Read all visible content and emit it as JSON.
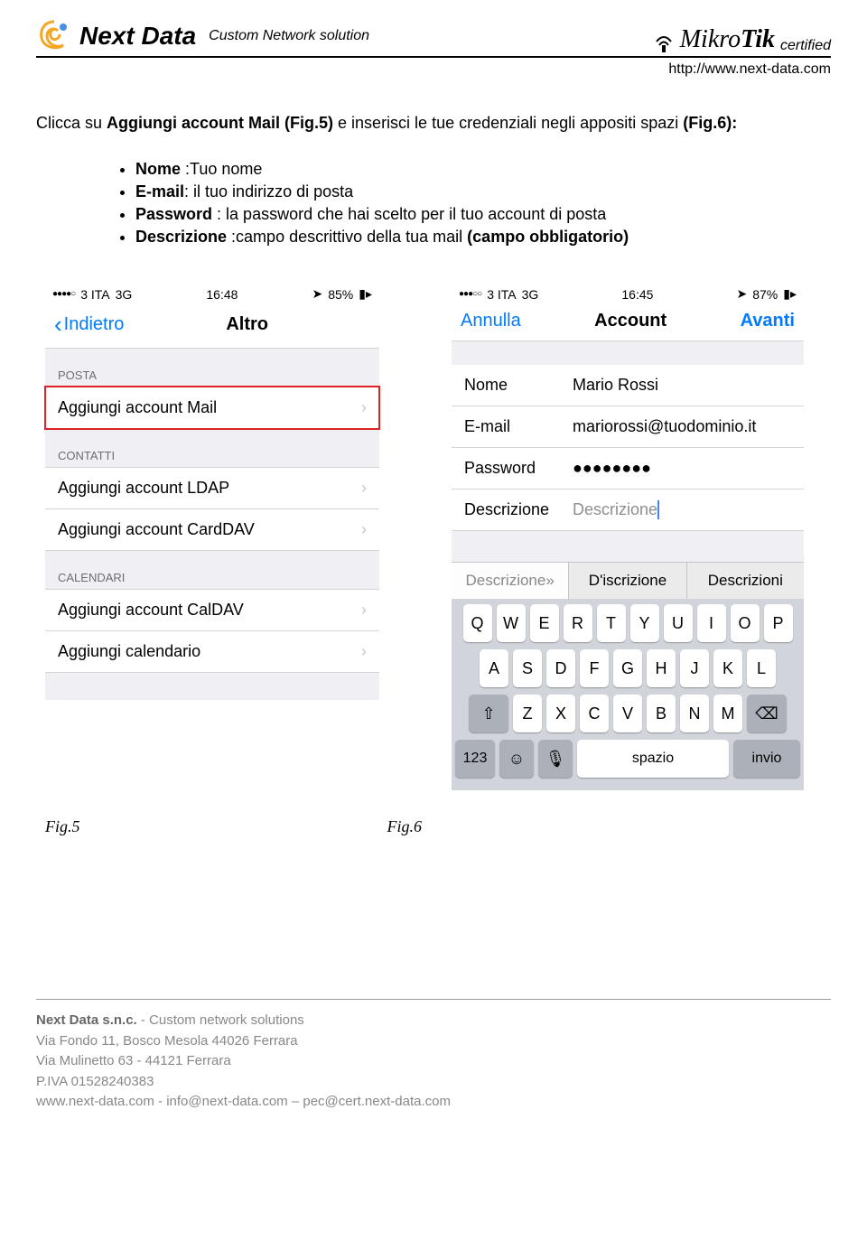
{
  "header": {
    "brand": "Next Data",
    "tagline": "Custom Network solution",
    "partner_brand": "MikroTik",
    "certified": "certified",
    "url": "http://www.next-data.com"
  },
  "intro": {
    "prefix": "Clicca su ",
    "bold1": "Aggiungi account Mail (Fig.5)",
    "mid": " e inserisci le tue credenziali negli appositi spazi ",
    "bold2": "(Fig.6):"
  },
  "bullets": [
    {
      "label": "Nome",
      "text": " :Tuo nome"
    },
    {
      "label": "E-mail",
      "text": ": il tuo indirizzo di posta"
    },
    {
      "label": "Password",
      "text": " : la password che hai scelto per il tuo account di posta"
    },
    {
      "label": "Descrizione",
      "text": " :campo descrittivo della tua mail ",
      "trailing_bold": "(campo obbligatorio)"
    }
  ],
  "fig5": {
    "status": {
      "carrier_dots": "●●●●○",
      "carrier": "3 ITA",
      "network": "3G",
      "time": "16:48",
      "battery_pct": "85%"
    },
    "nav": {
      "back": "Indietro",
      "title": "Altro"
    },
    "sections": [
      {
        "header": "POSTA",
        "items": [
          {
            "label": "Aggiungi account Mail",
            "highlight": true
          }
        ]
      },
      {
        "header": "CONTATTI",
        "items": [
          {
            "label": "Aggiungi account LDAP"
          },
          {
            "label": "Aggiungi account CardDAV"
          }
        ]
      },
      {
        "header": "CALENDARI",
        "items": [
          {
            "label": "Aggiungi account CalDAV"
          },
          {
            "label": "Aggiungi calendario"
          }
        ]
      }
    ]
  },
  "fig6": {
    "status": {
      "carrier_dots": "●●●○○",
      "carrier": "3 ITA",
      "network": "3G",
      "time": "16:45",
      "battery_pct": "87%"
    },
    "nav": {
      "left": "Annulla",
      "title": "Account",
      "right": "Avanti"
    },
    "form": {
      "rows": [
        {
          "label": "Nome",
          "value": "Mario Rossi"
        },
        {
          "label": "E-mail",
          "value": "mariorossi@tuodominio.it"
        },
        {
          "label": "Password",
          "value": "●●●●●●●●"
        },
        {
          "label": "Descrizione",
          "value": "Descrizione",
          "cursor": true,
          "muted": true
        }
      ]
    },
    "suggestions": [
      "Descrizione»",
      "D'iscrizione",
      "Descrizioni"
    ],
    "keyboard": {
      "row1": [
        "Q",
        "W",
        "E",
        "R",
        "T",
        "Y",
        "U",
        "I",
        "O",
        "P"
      ],
      "row2": [
        "A",
        "S",
        "D",
        "F",
        "G",
        "H",
        "J",
        "K",
        "L"
      ],
      "row3": [
        "Z",
        "X",
        "C",
        "V",
        "B",
        "N",
        "M"
      ],
      "shift": "⇧",
      "backspace": "⌫",
      "num": "123",
      "emoji": "☺",
      "mic": "🎤",
      "space": "spazio",
      "enter": "invio"
    }
  },
  "captions": {
    "left": "Fig.5",
    "right": "Fig.6"
  },
  "footer": {
    "line1a": "Next Data s.n.c.",
    "line1b": " - Custom network solutions",
    "line2": "Via Fondo 11, Bosco Mesola 44026 Ferrara",
    "line3": "Via Mulinetto 63 - 44121 Ferrara",
    "line4": "P.IVA 01528240383",
    "line5": "www.next-data.com - info@next-data.com – pec@cert.next-data.com"
  }
}
